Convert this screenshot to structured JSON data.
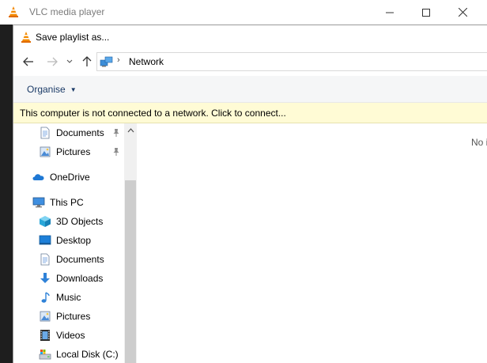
{
  "vlc": {
    "title": "VLC media player"
  },
  "dialog": {
    "title": "Save playlist as...",
    "address": {
      "location": "Network"
    },
    "toolbar": {
      "organise_label": "Organise"
    },
    "infobar": {
      "message": "This computer is not connected to a network. Click to connect..."
    },
    "nav_pane": {
      "quick_access": [
        {
          "label": "Documents",
          "icon": "documents-icon",
          "pinned": true
        },
        {
          "label": "Pictures",
          "icon": "pictures-icon",
          "pinned": true
        }
      ],
      "onedrive": {
        "label": "OneDrive",
        "icon": "onedrive-icon"
      },
      "this_pc": {
        "label": "This PC",
        "icon": "this-pc-icon"
      },
      "pc_items": [
        {
          "label": "3D Objects",
          "icon": "3d-objects-icon"
        },
        {
          "label": "Desktop",
          "icon": "desktop-icon"
        },
        {
          "label": "Documents",
          "icon": "documents-icon"
        },
        {
          "label": "Downloads",
          "icon": "downloads-icon"
        },
        {
          "label": "Music",
          "icon": "music-icon"
        },
        {
          "label": "Pictures",
          "icon": "pictures-icon"
        },
        {
          "label": "Videos",
          "icon": "videos-icon"
        },
        {
          "label": "Local Disk (C:)",
          "icon": "local-disk-icon"
        }
      ]
    },
    "content": {
      "empty_text": "No i"
    }
  },
  "colors": {
    "infobar_bg": "#fffbd5",
    "toolbar_bg": "#f5f6f7",
    "link_blue": "#1a3a66",
    "vlc_orange": "#f48b00"
  }
}
